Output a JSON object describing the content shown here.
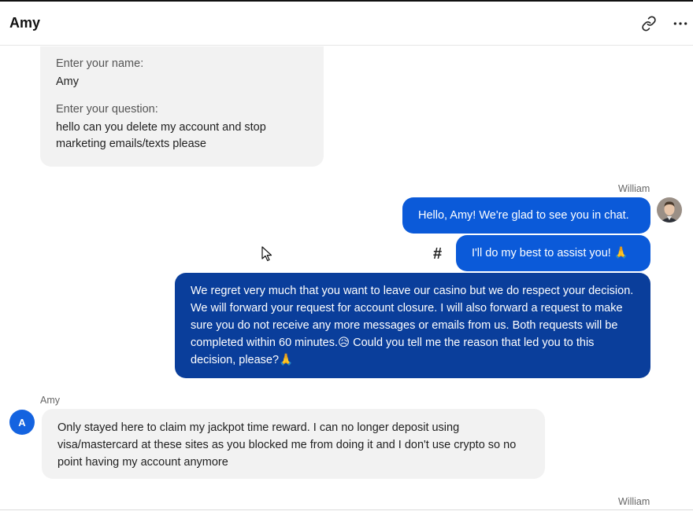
{
  "header": {
    "title": "Amy",
    "link_icon": "link-icon",
    "more_icon": "more-horizontal-icon"
  },
  "form_message": {
    "name_label": "Enter your name:",
    "name_value": "Amy",
    "question_label": "Enter your question:",
    "question_value": "hello can you delete my account and stop marketing emails/texts please"
  },
  "messages": [
    {
      "sender": "William",
      "text": "Hello, Amy! We're glad to see you in chat."
    },
    {
      "text": "I'll do my best to assist you! 🙏",
      "action_icon": "hash-icon"
    },
    {
      "text": "We regret very much that you want to leave our casino but we do respect your decision. We will forward your request for account closure. I will also forward a request to make sure you do not receive any more messages or emails from us. Both requests will be completed within 60 minutes.😥 Could you tell me the reason that led you to this decision, please?🙏"
    },
    {
      "sender": "Amy",
      "avatar_letter": "A",
      "text": "Only stayed here to claim my jackpot time reward. I can no longer deposit using visa/mastercard at these sites as you blocked me from doing it and I don't use crypto so no point having my account anymore"
    },
    {
      "sender": "William"
    }
  ],
  "colors": {
    "agent_bubble": "#0b5ad9",
    "agent_bubble_dark": "#0a3e9b",
    "user_bubble": "#f2f2f2",
    "amy_avatar": "#1463e0"
  }
}
